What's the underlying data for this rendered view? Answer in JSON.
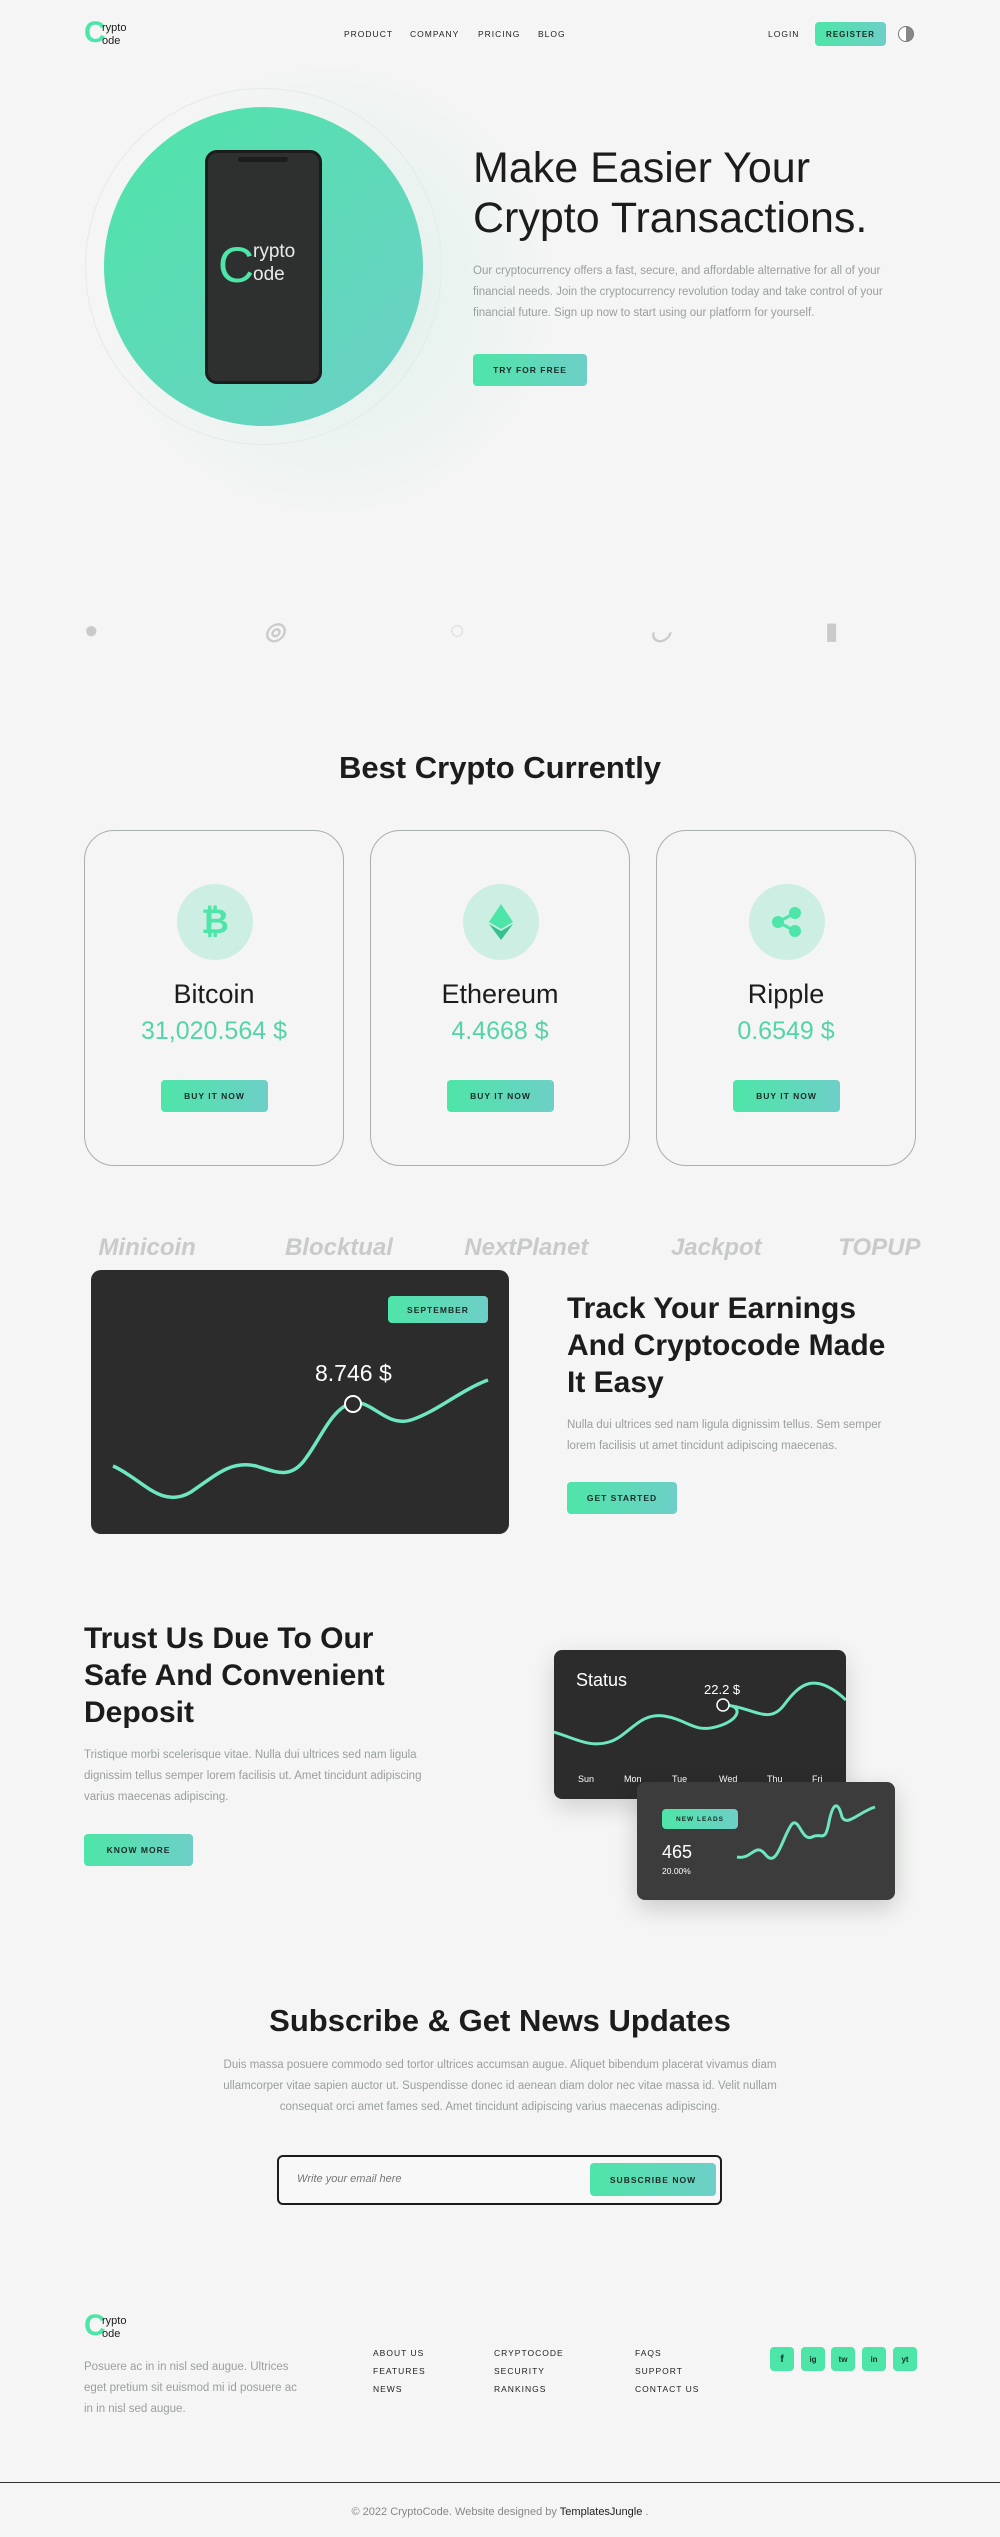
{
  "brand": {
    "logo_top": "rypto",
    "logo_bottom": "ode",
    "logo_letter": "C"
  },
  "nav": {
    "product": "PRODUCT",
    "company": "COMPANY",
    "pricing": "PRICING",
    "blog": "BLOG",
    "login": "LOGIN",
    "register": "REGISTER"
  },
  "hero": {
    "title_line1": "Make Easier Your",
    "title_line2": "Crypto Transactions.",
    "description": "Our cryptocurrency offers a fast, secure, and affordable alternative for all of your financial needs. Join the cryptocurrency revolution today and take control of your financial future. Sign up now to start using our platform for yourself.",
    "cta": "TRY FOR FREE",
    "phone_logo_top": "rypto",
    "phone_logo_bottom": "ode"
  },
  "partners": [
    "Minicoin",
    "Blocktual",
    "NextPlanet",
    "Jackpot",
    "TOPUP"
  ],
  "best": {
    "title": "Best Crypto Currently",
    "coins": [
      {
        "name": "Bitcoin",
        "price": "31,020.564 $",
        "button": "BUY IT NOW",
        "icon": "bitcoin-icon"
      },
      {
        "name": "Ethereum",
        "price": "4.4668 $",
        "button": "BUY IT NOW",
        "icon": "ethereum-icon"
      },
      {
        "name": "Ripple",
        "price": "0.6549 $",
        "button": "BUY IT NOW",
        "icon": "ripple-icon"
      }
    ]
  },
  "track": {
    "badge": "SEPTEMBER",
    "value": "8.746 $",
    "title_line1": "Track Your Earnings",
    "title_line2": "And Cryptocode Made",
    "title_line3": "It Easy",
    "description": "Nulla dui ultrices sed nam ligula dignissim tellus. Sem semper lorem facilisis ut amet tincidunt adipiscing maecenas.",
    "cta": "GET STARTED"
  },
  "trust": {
    "title_line1": "Trust Us Due To Our",
    "title_line2": "Safe And Convenient",
    "title_line3": "Deposit",
    "description": "Tristique morbi scelerisque vitae. Nulla dui ultrices sed nam ligula dignissim tellus semper lorem facilisis ut. Amet tincidunt adipiscing varius maecenas adipiscing.",
    "cta": "KNOW MORE",
    "status_title": "Status",
    "status_value": "22.2 $",
    "days": [
      "Sun",
      "Mon",
      "Tue",
      "Wed",
      "Thu",
      "Fri"
    ],
    "leads_badge": "NEW LEADS",
    "leads_count": "465",
    "leads_percent": "20.00%"
  },
  "subscribe": {
    "title": "Subscribe & Get News Updates",
    "description": "Duis massa posuere commodo sed tortor ultrices accumsan augue. Aliquet bibendum placerat vivamus diam ullamcorper vitae sapien auctor ut. Suspendisse donec id aenean diam dolor nec vitae massa id. Velit nullam consequat orci amet fames sed. Amet tincidunt adipiscing varius maecenas adipiscing.",
    "placeholder": "Write your email here",
    "button": "SUBSCRIBE NOW"
  },
  "footer": {
    "description": "Posuere ac in in nisl sed augue. Ultrices eget pretium sit euismod mi id posuere ac in in nisl sed augue.",
    "col1": [
      "ABOUT US",
      "FEATURES",
      "NEWS"
    ],
    "col2": [
      "CRYPTOCODE",
      "SECURITY",
      "RANKINGS"
    ],
    "col3": [
      "FAQS",
      "SUPPORT",
      "CONTACT US"
    ],
    "social": [
      "f",
      "ig",
      "tw",
      "in",
      "yt"
    ],
    "copyright": "© 2022 CryptoCode. Website designed by",
    "designer": "TemplatesJungle",
    "period": "."
  },
  "colors": {
    "accent": "#4ee5a8",
    "accent2": "#6dcfc7",
    "dark": "#2b2c2b"
  }
}
